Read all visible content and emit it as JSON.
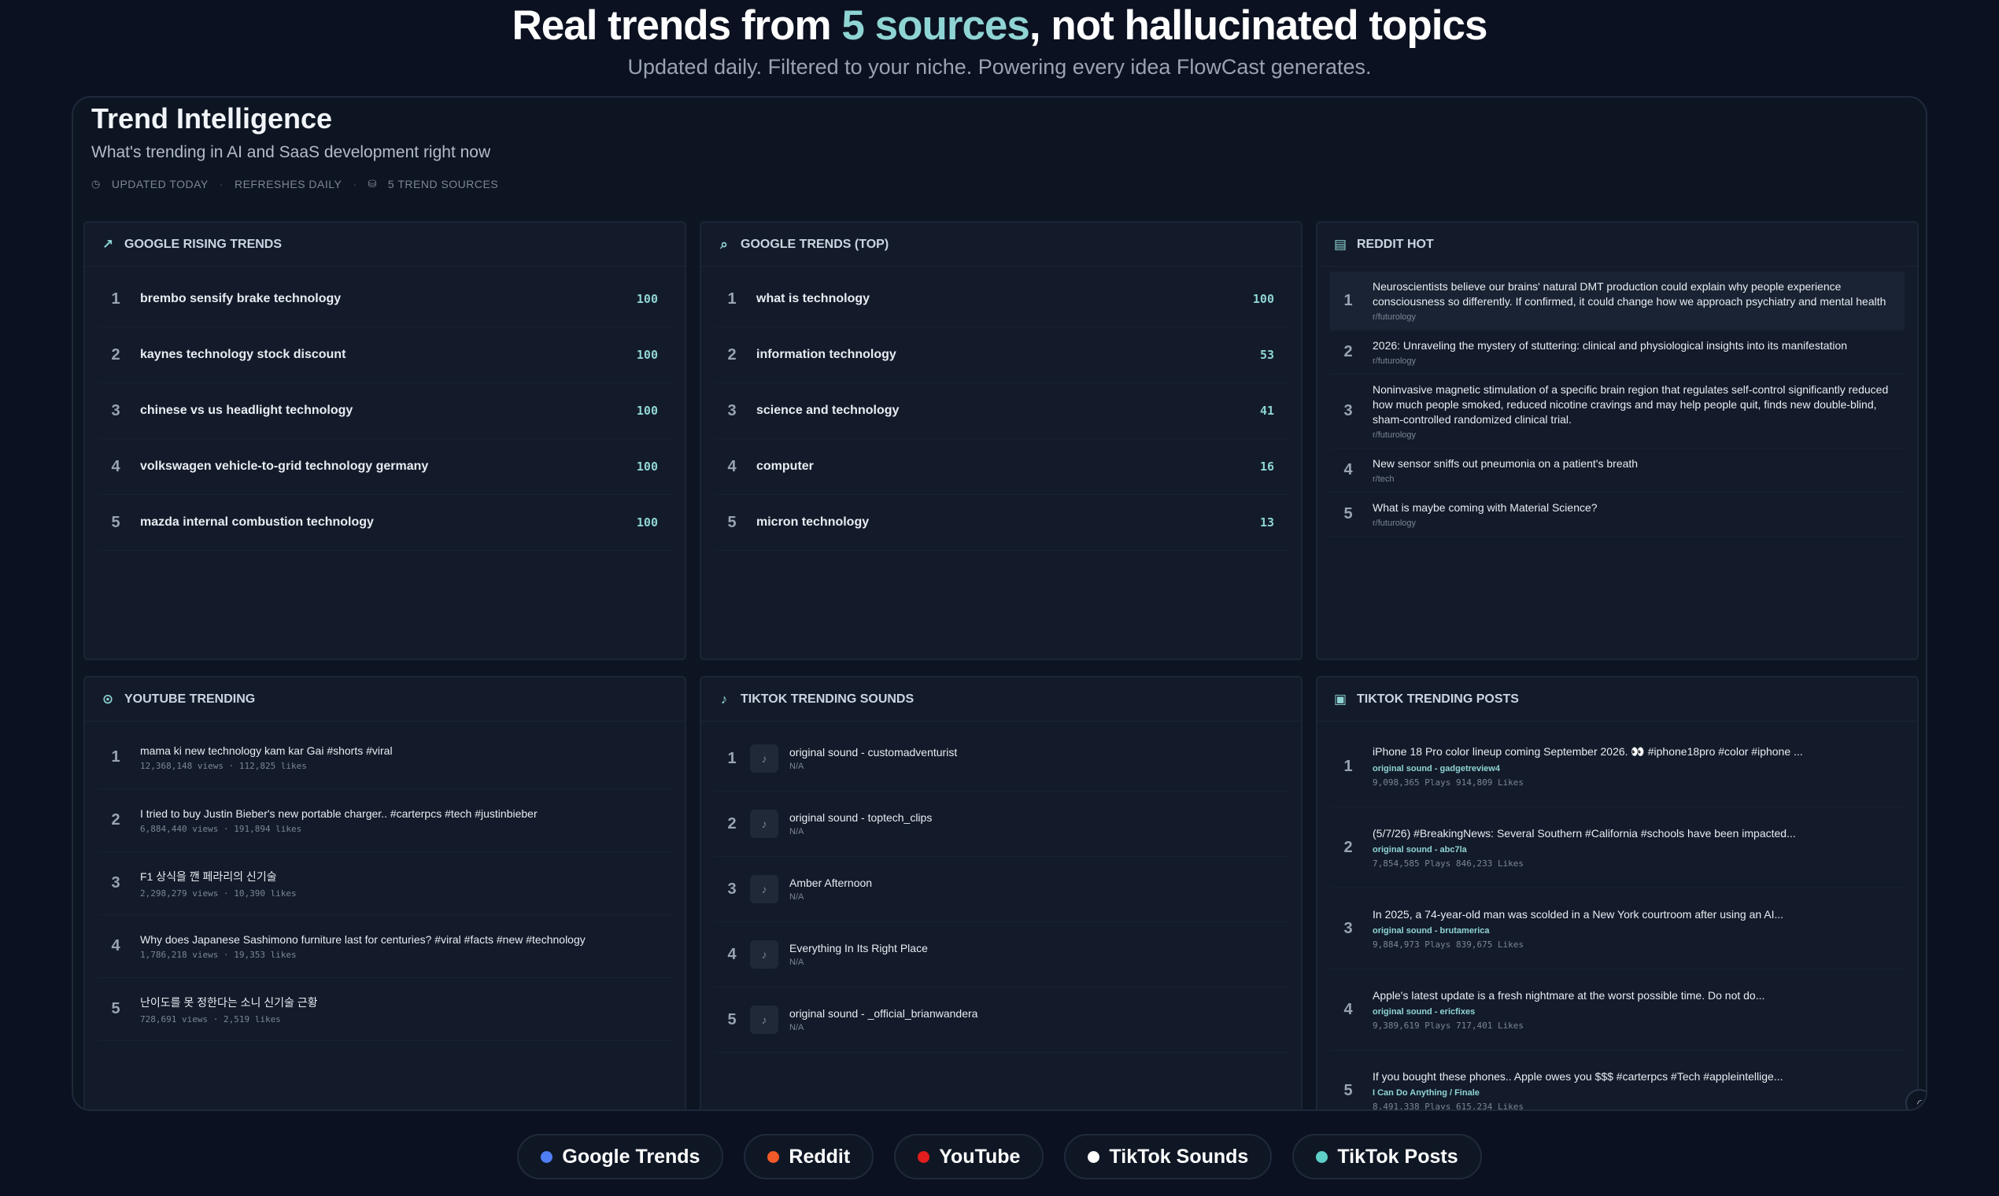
{
  "hero": {
    "title_pre": "Real trends from ",
    "title_accent": "5 sources",
    "title_post": ", not hallucinated topics",
    "subtitle": "Updated daily. Filtered to your niche. Powering every idea FlowCast generates."
  },
  "panel": {
    "title": "Trend Intelligence",
    "subtitle": "What's trending in AI and SaaS development right now",
    "meta": [
      "UPDATED TODAY",
      "REFRESHES DAILY",
      "5 TREND SOURCES"
    ]
  },
  "google_rising": {
    "title": "GOOGLE RISING TRENDS",
    "items": [
      {
        "rank": "1",
        "term": "brembo sensify brake technology",
        "score": "100"
      },
      {
        "rank": "2",
        "term": "kaynes technology stock discount",
        "score": "100"
      },
      {
        "rank": "3",
        "term": "chinese vs us headlight technology",
        "score": "100"
      },
      {
        "rank": "4",
        "term": "volkswagen vehicle-to-grid technology germany",
        "score": "100"
      },
      {
        "rank": "5",
        "term": "mazda internal combustion technology",
        "score": "100"
      }
    ]
  },
  "google_top": {
    "title": "GOOGLE TRENDS (TOP)",
    "items": [
      {
        "rank": "1",
        "term": "what is technology",
        "score": "100"
      },
      {
        "rank": "2",
        "term": "information technology",
        "score": "53"
      },
      {
        "rank": "3",
        "term": "science and technology",
        "score": "41"
      },
      {
        "rank": "4",
        "term": "computer",
        "score": "16"
      },
      {
        "rank": "5",
        "term": "micron technology",
        "score": "13"
      }
    ]
  },
  "reddit": {
    "title": "REDDIT HOT",
    "items": [
      {
        "rank": "1",
        "title": "Neuroscientists believe our brains' natural DMT production could explain why people experience consciousness so differently. If confirmed, it could change how we approach psychiatry and mental health",
        "sub": "r/futurology"
      },
      {
        "rank": "2",
        "title": "2026: Unraveling the mystery of stuttering: clinical and physiological insights into its manifestation",
        "sub": "r/futurology"
      },
      {
        "rank": "3",
        "title": "Noninvasive magnetic stimulation of a specific brain region that regulates self-control significantly reduced how much people smoked, reduced nicotine cravings and may help people quit, finds new double-blind, sham-controlled randomized clinical trial.",
        "sub": "r/futurology"
      },
      {
        "rank": "4",
        "title": "New sensor sniffs out pneumonia on a patient's breath",
        "sub": "r/tech"
      },
      {
        "rank": "5",
        "title": "What is maybe coming with Material Science?",
        "sub": "r/futurology"
      }
    ]
  },
  "youtube": {
    "title": "YOUTUBE TRENDING",
    "items": [
      {
        "rank": "1",
        "title": "mama ki new technology kam kar Gai #shorts #viral",
        "stats": "12,368,148 views · 112,825 likes"
      },
      {
        "rank": "2",
        "title": "I tried to buy Justin Bieber's new portable charger.. #carterpcs #tech #justinbieber",
        "stats": "6,884,440 views · 191,894 likes"
      },
      {
        "rank": "3",
        "title": "F1 상식을 깬 페라리의 신기술",
        "stats": "2,298,279 views · 10,390 likes"
      },
      {
        "rank": "4",
        "title": "Why does Japanese Sashimono furniture last for centuries? #viral #facts #new #technology",
        "stats": "1,786,218 views · 19,353 likes"
      },
      {
        "rank": "5",
        "title": "난이도를 못 정한다는 소니 신기술 근황",
        "stats": "728,691 views · 2,519 likes"
      }
    ]
  },
  "tiktok_sounds": {
    "title": "TIKTOK TRENDING SOUNDS",
    "items": [
      {
        "rank": "1",
        "title": "original sound - customadventurist",
        "sub": "N/A"
      },
      {
        "rank": "2",
        "title": "original sound - toptech_clips",
        "sub": "N/A"
      },
      {
        "rank": "3",
        "title": "Amber Afternoon",
        "sub": "N/A"
      },
      {
        "rank": "4",
        "title": "Everything In Its Right Place",
        "sub": "N/A"
      },
      {
        "rank": "5",
        "title": "original sound - _official_brianwandera",
        "sub": "N/A"
      }
    ]
  },
  "tiktok_posts": {
    "title": "TIKTOK TRENDING POSTS",
    "items": [
      {
        "rank": "1",
        "title": "iPhone 18 Pro color lineup coming September 2026. 👀 #iphone18pro #color #iphone ...",
        "sound": "original sound - gadgetreview4",
        "stats": "9,098,365 Plays  914,809 Likes"
      },
      {
        "rank": "2",
        "title": "(5/7/26) #BreakingNews: Several Southern #California #schools have been impacted...",
        "sound": "original sound - abc7la",
        "stats": "7,854,585 Plays  846,233 Likes"
      },
      {
        "rank": "3",
        "title": "In 2025, a 74-year-old man was scolded in a New York courtroom after using an AI...",
        "sound": "original sound - brutamerica",
        "stats": "9,884,973 Plays  839,675 Likes"
      },
      {
        "rank": "4",
        "title": "Apple's latest update is a fresh nightmare at the worst possible time. Do not do...",
        "sound": "original sound - ericfixes",
        "stats": "9,389,619 Plays  717,401 Likes"
      },
      {
        "rank": "5",
        "title": "If you bought these phones.. Apple owes you $$$ #carterpcs #Tech #appleintellige...",
        "sound": "I Can Do Anything / Finale",
        "stats": "8,491,338 Plays  615,234 Likes"
      }
    ]
  },
  "chips": [
    {
      "label": "Google Trends",
      "color": "#4f7df3"
    },
    {
      "label": "Reddit",
      "color": "#f05a28"
    },
    {
      "label": "YouTube",
      "color": "#e11d1d"
    },
    {
      "label": "TikTok Sounds",
      "color": "#ffffff"
    },
    {
      "label": "TikTok Posts",
      "color": "#5fd0c8"
    }
  ],
  "icons": {
    "google_rising": "trending-up-icon",
    "google_top": "search-icon",
    "reddit": "chat-icon",
    "youtube": "play-circle-icon",
    "tiktok_sounds": "music-note-icon",
    "tiktok_posts": "video-icon"
  }
}
